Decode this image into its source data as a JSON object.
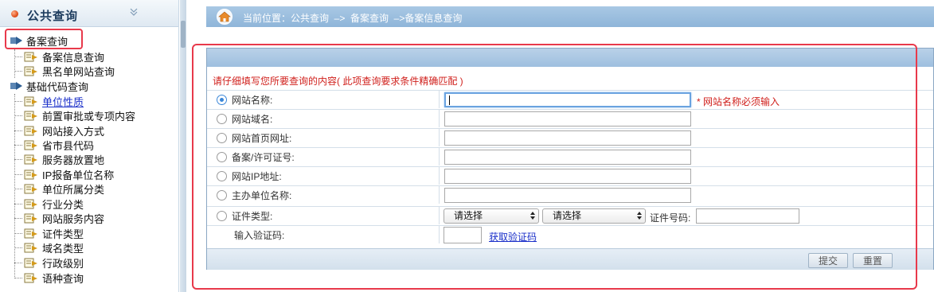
{
  "sidebar": {
    "title": "公共查询",
    "groups": [
      {
        "label": "备案查询",
        "items": [
          {
            "label": "备案信息查询"
          },
          {
            "label": "黑名单网站查询"
          }
        ]
      },
      {
        "label": "基础代码查询",
        "items": [
          {
            "label": "单位性质",
            "active": true
          },
          {
            "label": "前置审批或专项内容"
          },
          {
            "label": "网站接入方式"
          },
          {
            "label": "省市县代码"
          },
          {
            "label": "服务器放置地"
          },
          {
            "label": "IP报备单位名称"
          },
          {
            "label": "单位所属分类"
          },
          {
            "label": "行业分类"
          },
          {
            "label": "网站服务内容"
          },
          {
            "label": "证件类型"
          },
          {
            "label": "域名类型"
          },
          {
            "label": "行政级别"
          },
          {
            "label": "语种查询"
          }
        ]
      }
    ]
  },
  "breadcrumb": {
    "text": "当前位置：公共查询  –>  备案查询  –>备案信息查询"
  },
  "form": {
    "instruction": "请仔细填写您所要查询的内容( 此项查询要求条件精确匹配 )",
    "fields": [
      {
        "label": "网站名称:",
        "value": "",
        "selected": true
      },
      {
        "label": "网站域名:",
        "value": ""
      },
      {
        "label": "网站首页网址:",
        "value": ""
      },
      {
        "label": "备案/许可证号:",
        "value": ""
      },
      {
        "label": "网站IP地址:",
        "value": ""
      },
      {
        "label": "主办单位名称:",
        "value": ""
      }
    ],
    "required_note": "* 网站名称必须输入",
    "cert": {
      "label": "证件类型:",
      "select1": "请选择",
      "select2": "请选择",
      "number_label": "证件号码:"
    },
    "captcha": {
      "label": "输入验证码:",
      "link": "获取验证码"
    },
    "submit_label": "提交",
    "reset_label": "重置"
  },
  "colors": {
    "highlight_border": "#e8394b",
    "breadcrumb_bg": "#9fbfdf",
    "required_text": "#d0201c",
    "link": "#1a2fc9"
  }
}
